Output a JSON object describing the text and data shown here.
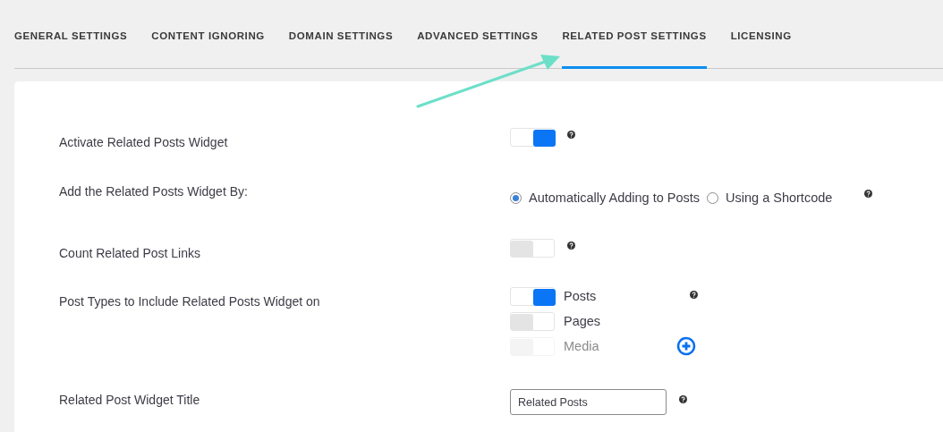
{
  "tabs": [
    {
      "label": "GENERAL SETTINGS",
      "selected": false
    },
    {
      "label": "CONTENT IGNORING",
      "selected": false
    },
    {
      "label": "DOMAIN SETTINGS",
      "selected": false
    },
    {
      "label": "ADVANCED SETTINGS",
      "selected": false
    },
    {
      "label": "RELATED POST SETTINGS",
      "selected": true
    },
    {
      "label": "LICENSING",
      "selected": false
    }
  ],
  "settings": [
    {
      "kind": "toggle",
      "label": "Activate Related Posts Widget",
      "on": true
    },
    {
      "kind": "radio",
      "label": "Add the Related Posts Widget By:",
      "options": [
        {
          "label": "Automatically Adding to Posts",
          "selected": true
        },
        {
          "label": "Using a Shortcode",
          "selected": false
        }
      ]
    },
    {
      "kind": "toggle",
      "label": "Count Related Post Links",
      "on": false
    },
    {
      "kind": "toggle_list",
      "label": "Post Types to Include Related Posts Widget on",
      "items": [
        {
          "label": "Posts",
          "on": true
        },
        {
          "label": "Pages",
          "on": false
        },
        {
          "label": "Media",
          "on": false
        }
      ]
    },
    {
      "kind": "text",
      "label": "Related Post Widget Title",
      "value": "Related Posts"
    }
  ]
}
